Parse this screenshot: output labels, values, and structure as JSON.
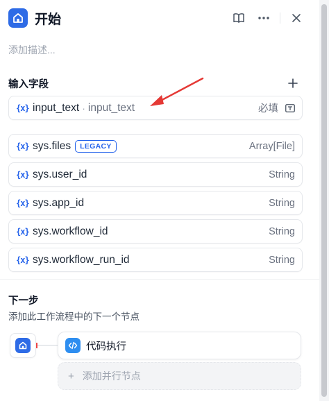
{
  "header": {
    "title": "开始",
    "icons": [
      "home-icon",
      "book-icon",
      "more-icon",
      "close-icon"
    ]
  },
  "description_placeholder": "添加描述...",
  "input_section": {
    "title": "输入字段",
    "fields": [
      {
        "name": "input_text",
        "separator": "·",
        "label": "input_text",
        "required": "必填"
      }
    ]
  },
  "system_vars": [
    {
      "name": "sys.files",
      "badge": "LEGACY",
      "type": "Array[File]"
    },
    {
      "name": "sys.user_id",
      "type": "String"
    },
    {
      "name": "sys.app_id",
      "type": "String"
    },
    {
      "name": "sys.workflow_id",
      "type": "String"
    },
    {
      "name": "sys.workflow_run_id",
      "type": "String"
    }
  ],
  "next_step": {
    "title": "下一步",
    "subtitle": "添加此工作流程中的下一个节点",
    "next_node": "代码执行",
    "add_parallel": "添加并行节点"
  },
  "colors": {
    "accent": "#2e6be6",
    "annotation_arrow": "#e53935"
  }
}
